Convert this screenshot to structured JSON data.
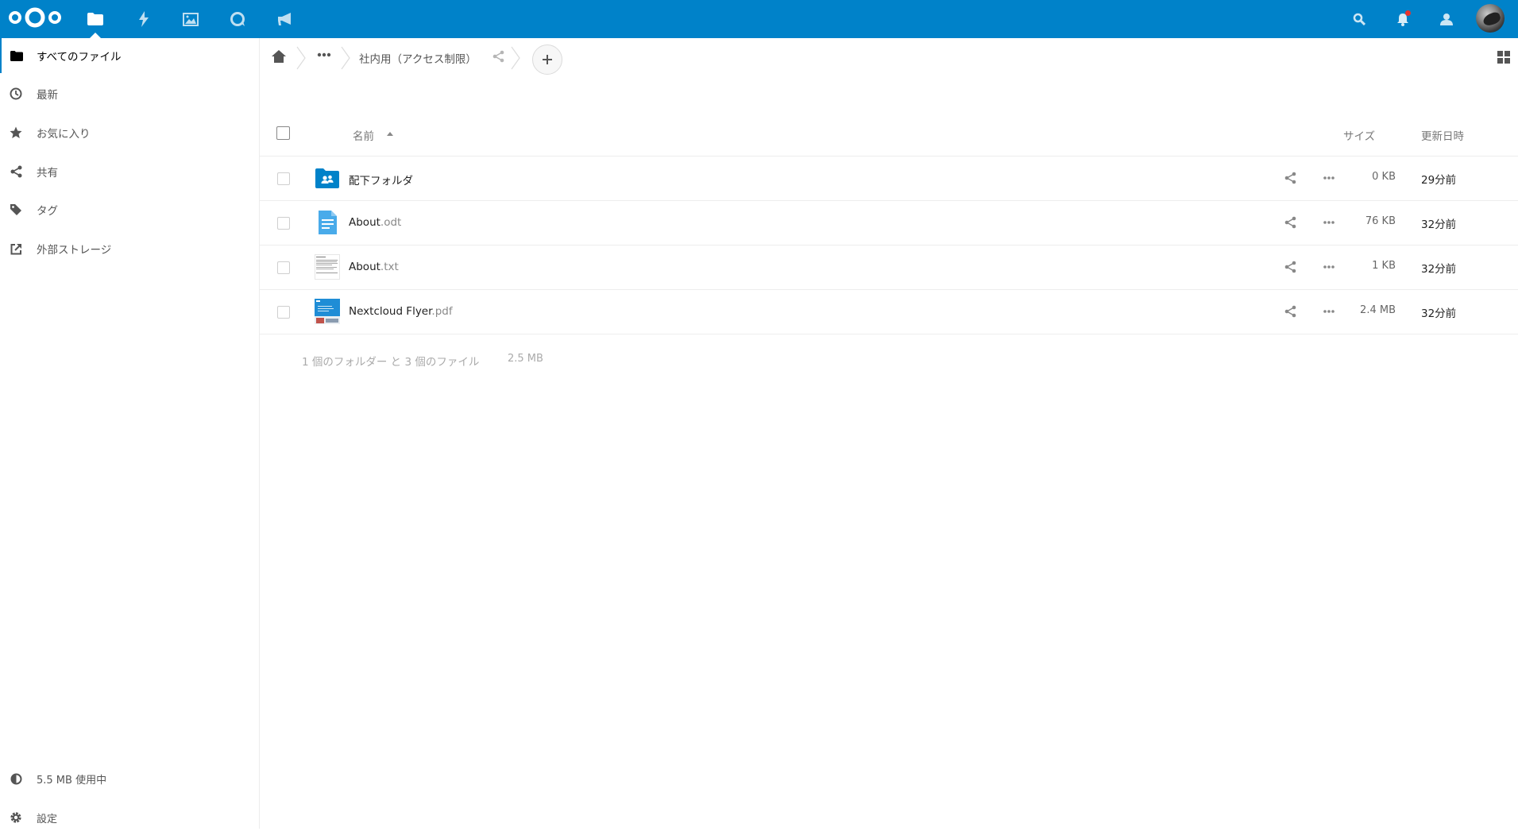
{
  "header": {
    "apps": [
      "files-icon",
      "activity-icon",
      "gallery-icon",
      "talk-icon",
      "announcements-icon"
    ],
    "right": [
      "search-icon",
      "notifications-icon",
      "contacts-icon"
    ]
  },
  "sidebar": {
    "items": [
      {
        "label": "すべてのファイル",
        "icon": "folder-icon"
      },
      {
        "label": "最新",
        "icon": "clock-icon"
      },
      {
        "label": "お気に入り",
        "icon": "star-icon"
      },
      {
        "label": "共有",
        "icon": "share-icon"
      },
      {
        "label": "タグ",
        "icon": "tag-icon"
      },
      {
        "label": "外部ストレージ",
        "icon": "external-link-icon"
      }
    ],
    "quota": "5.5 MB 使用中",
    "settings": "設定"
  },
  "breadcrumb": {
    "current": "社内用（アクセス制限）"
  },
  "table": {
    "headers": {
      "name": "名前",
      "size": "サイズ",
      "modified": "更新日時"
    },
    "rows": [
      {
        "base": "配下フォルダ",
        "ext": "",
        "size": "0 KB",
        "modified": "29分前",
        "type": "shared-folder"
      },
      {
        "base": "About",
        "ext": ".odt",
        "size": "76 KB",
        "modified": "32分前",
        "type": "document"
      },
      {
        "base": "About",
        "ext": ".txt",
        "size": "1 KB",
        "modified": "32分前",
        "type": "text"
      },
      {
        "base": "Nextcloud Flyer",
        "ext": ".pdf",
        "size": "2.4 MB",
        "modified": "32分前",
        "type": "pdf"
      }
    ],
    "summary": "1 個のフォルダー と 3 個のファイル",
    "summary_size": "2.5 MB"
  },
  "colors": {
    "header_bg": "#0082c9",
    "accent": "#0082c9"
  }
}
